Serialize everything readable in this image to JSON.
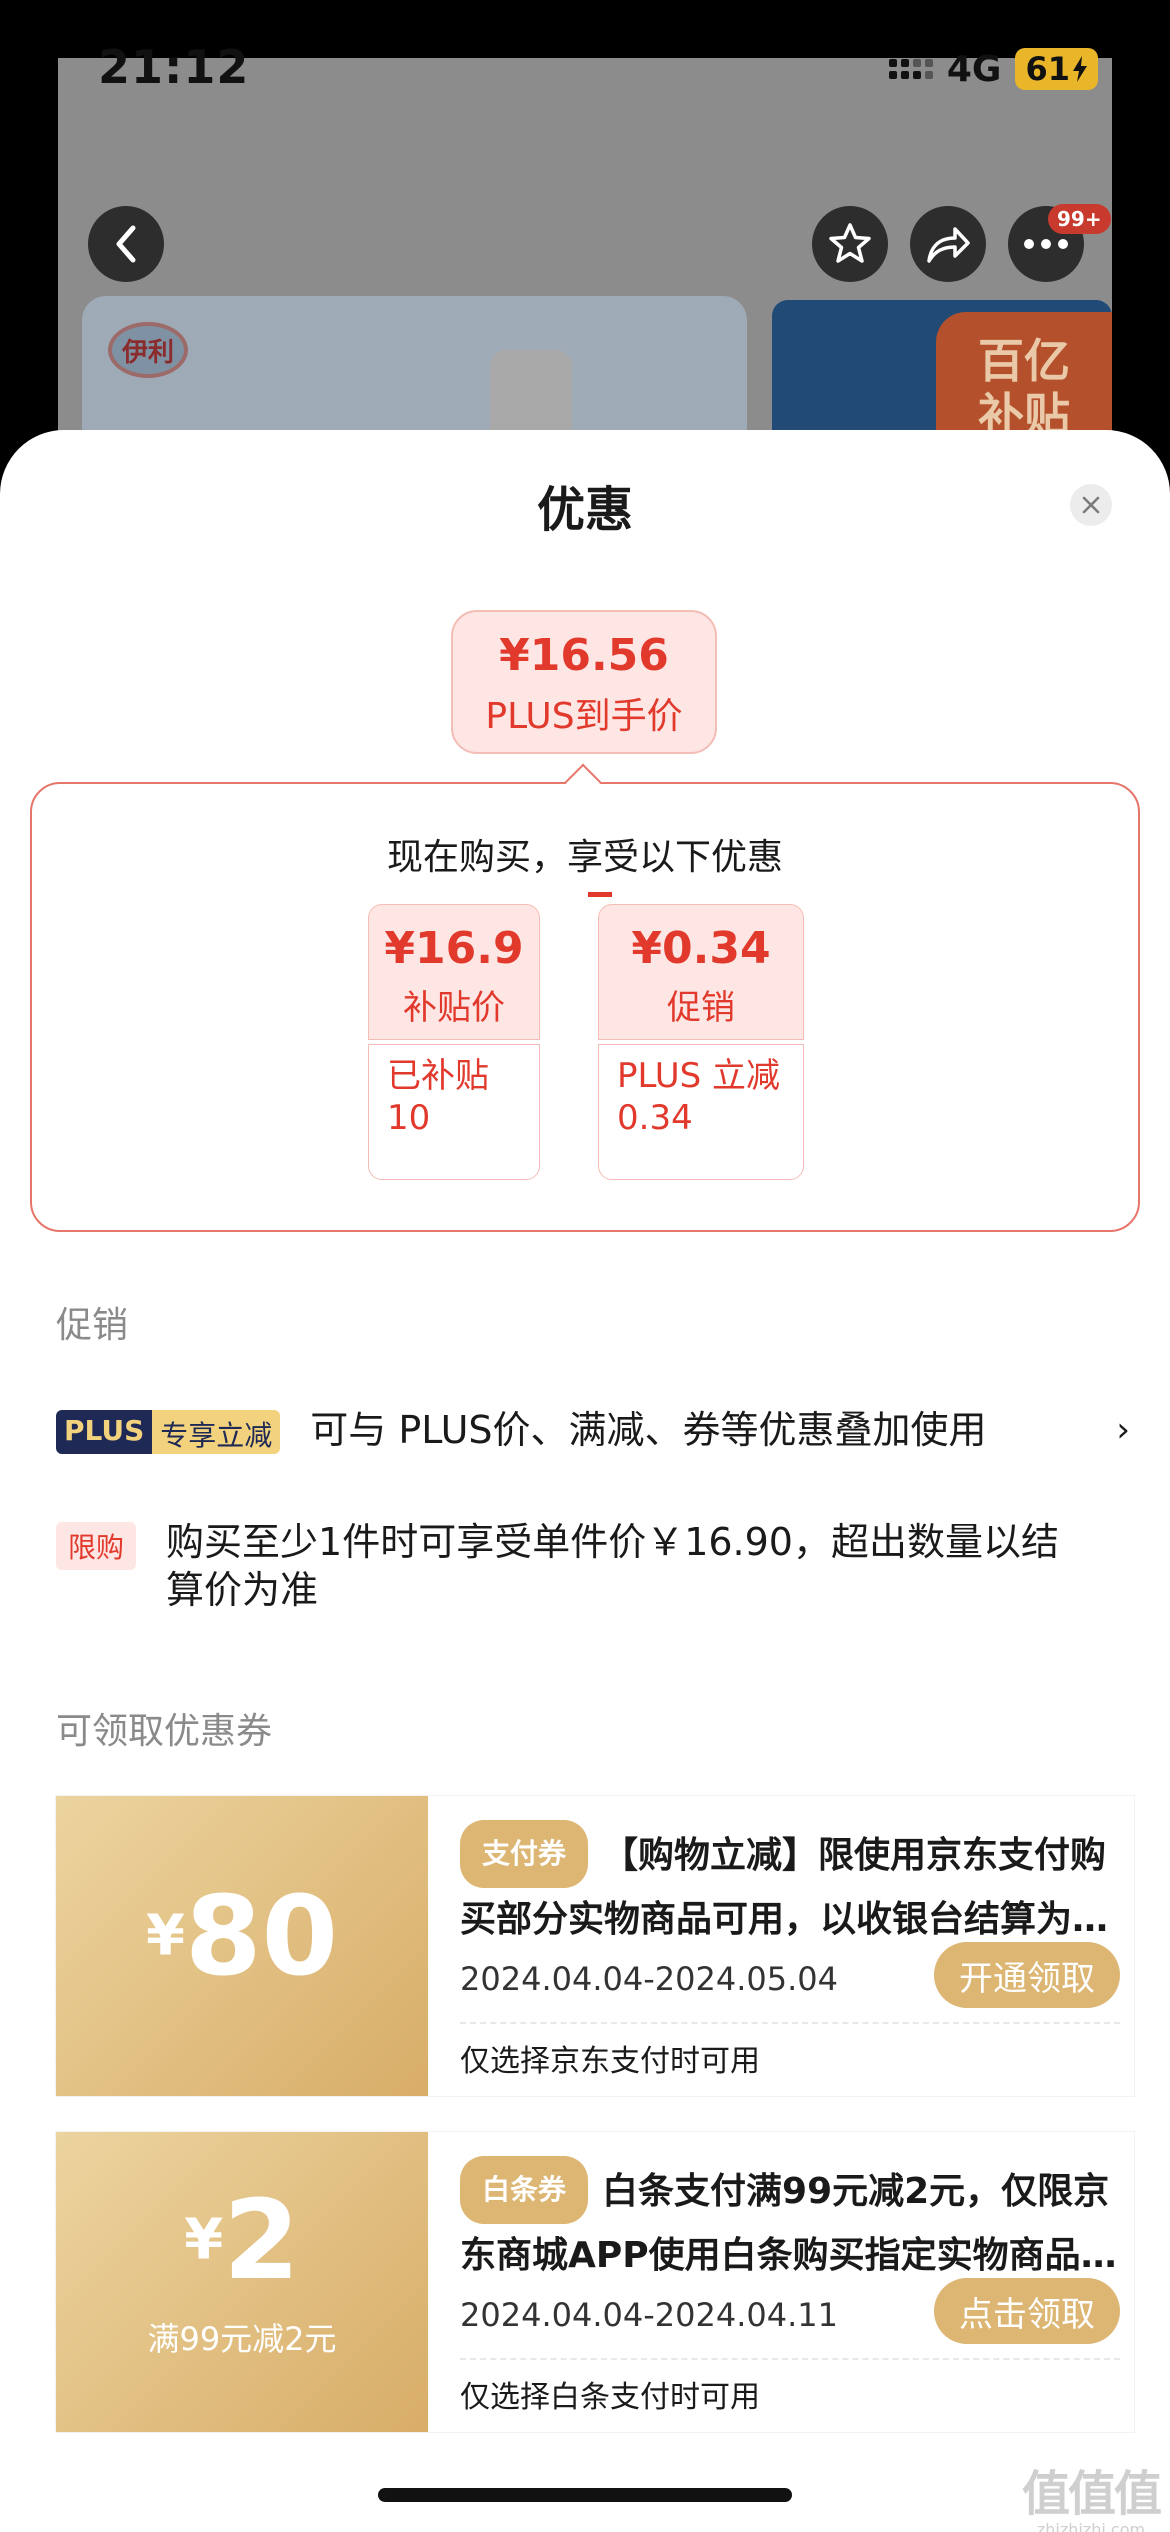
{
  "status_bar": {
    "time": "21:12",
    "network": "4G",
    "battery": "61"
  },
  "background_page": {
    "brand_logo_text": "伊利",
    "badge_count": "99+",
    "subsidy_banner": "百亿补贴"
  },
  "sheet": {
    "title": "优惠",
    "final_price": {
      "amount": "¥16.56",
      "label": "PLUS到手价"
    },
    "benefit": {
      "heading": "现在购买，享受以下优惠",
      "items": [
        {
          "value": "¥16.9",
          "name": "补贴价",
          "detail_line1": "已补贴",
          "detail_line2": "10"
        },
        {
          "value": "¥0.34",
          "name": "促销",
          "detail_line1": "PLUS 立减",
          "detail_line2": "0.34"
        }
      ]
    },
    "promotions": {
      "section_label": "促销",
      "plus": {
        "tag_plus": "PLUS",
        "tag_text": "专享立减",
        "text": "可与 PLUS价、满减、券等优惠叠加使用",
        "chevron": "›"
      },
      "limit": {
        "tag": "限购",
        "text": "购买至少1件时可享受单件价￥16.90，超出数量以结算价为准"
      }
    },
    "coupons": {
      "section_label": "可领取优惠券",
      "items": [
        {
          "currency": "¥",
          "amount": "80",
          "condition": "",
          "tag": "支付券",
          "title": "【购物立减】限使用京东支付购买部分实物商品可用，以收银台结算为…",
          "date": "2024.04.04-2024.05.04",
          "button": "开通领取",
          "note": "仅选择京东支付时可用"
        },
        {
          "currency": "¥",
          "amount": "2",
          "condition": "满99元减2元",
          "tag": "白条券",
          "title": "白条支付满99元减2元，仅限京东商城APP使用白条购买指定实物商品…",
          "date": "2024.04.04-2024.04.11",
          "button": "点击领取",
          "note": "仅选择白条支付时可用"
        }
      ]
    }
  },
  "watermark": {
    "line1": "值值值",
    "line2": "zhizhizhi.com"
  },
  "colors": {
    "accent_red": "#e2392d",
    "coupon_gold": "#dcb672",
    "plus_navy": "#1e2a55"
  }
}
